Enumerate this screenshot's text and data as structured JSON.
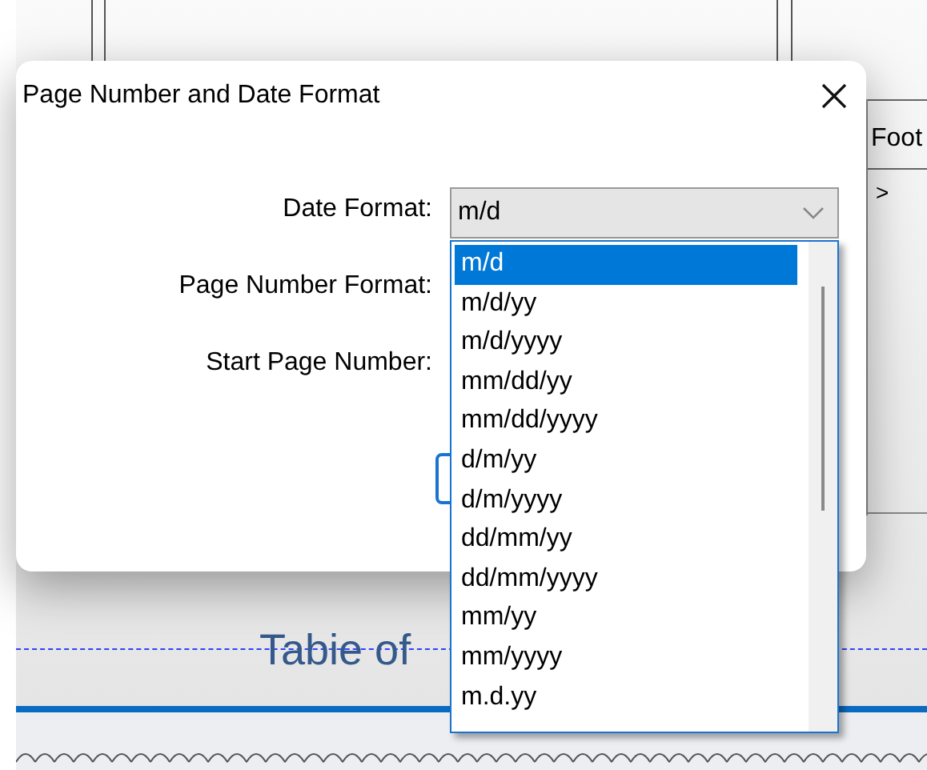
{
  "window": {
    "title": "Page Number and Date Format"
  },
  "form": {
    "fields": [
      {
        "label": "Date Format:",
        "value": "m/d"
      },
      {
        "label": "Page Number Format:"
      },
      {
        "label": "Start Page Number:"
      }
    ]
  },
  "dropdown": {
    "options": [
      {
        "label": "m/d",
        "selected": true
      },
      {
        "label": "m/d/yy",
        "selected": false
      },
      {
        "label": "m/d/yyyy",
        "selected": false
      },
      {
        "label": "mm/dd/yy",
        "selected": false
      },
      {
        "label": "mm/dd/yyyy",
        "selected": false
      },
      {
        "label": "d/m/yy",
        "selected": false
      },
      {
        "label": "d/m/yyyy",
        "selected": false
      },
      {
        "label": "dd/mm/yy",
        "selected": false
      },
      {
        "label": "dd/mm/yyyy",
        "selected": false
      },
      {
        "label": "mm/yy",
        "selected": false
      },
      {
        "label": "mm/yyyy",
        "selected": false
      },
      {
        "label": "m.d.yy",
        "selected": false
      }
    ]
  },
  "background": {
    "column_header": "Foot",
    "row_marker": ">",
    "heading": "Tabie of"
  }
}
